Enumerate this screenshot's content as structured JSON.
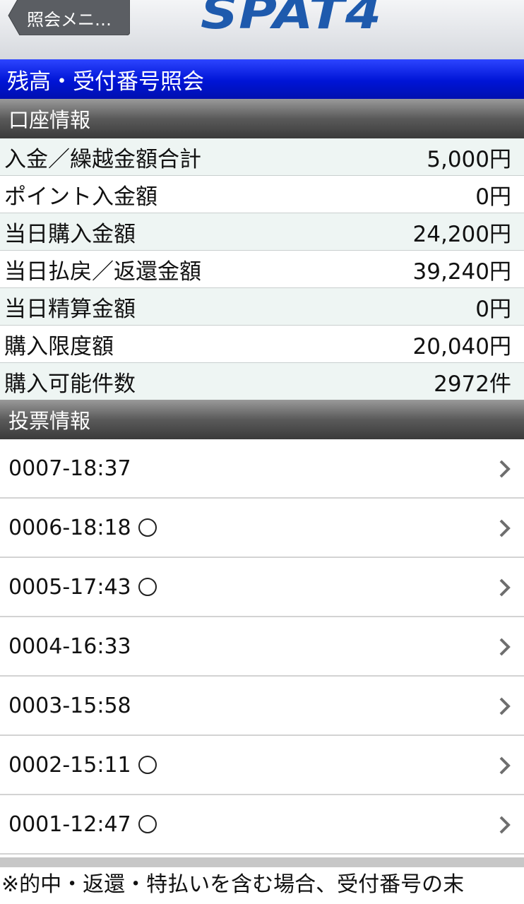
{
  "header": {
    "back_label": "照会メニ…",
    "logo_text": "SPAT4"
  },
  "title": "残高・受付番号照会",
  "account_section": {
    "heading": "口座情報",
    "rows": [
      {
        "label": "入金／繰越金額合計",
        "value": "5,000円"
      },
      {
        "label": "ポイント入金額",
        "value": "0円"
      },
      {
        "label": "当日購入金額",
        "value": "24,200円"
      },
      {
        "label": "当日払戻／返還金額",
        "value": "39,240円"
      },
      {
        "label": "当日精算金額",
        "value": "0円"
      },
      {
        "label": "購入限度額",
        "value": "20,040円"
      },
      {
        "label": "購入可能件数",
        "value": "2972件"
      }
    ]
  },
  "bet_section": {
    "heading": "投票情報",
    "items": [
      {
        "label": "0007-18:37",
        "hit": false
      },
      {
        "label": "0006-18:18",
        "hit": true
      },
      {
        "label": "0005-17:43",
        "hit": true
      },
      {
        "label": "0004-16:33",
        "hit": false
      },
      {
        "label": "0003-15:58",
        "hit": false
      },
      {
        "label": "0002-15:11",
        "hit": true
      },
      {
        "label": "0001-12:47",
        "hit": true
      }
    ]
  },
  "footer_note": "※的中・返還・特払いを含む場合、受付番号の末",
  "colors": {
    "title_bar": "#0014d6",
    "logo": "#1e5aad",
    "section_head": "#4a4a4a"
  }
}
